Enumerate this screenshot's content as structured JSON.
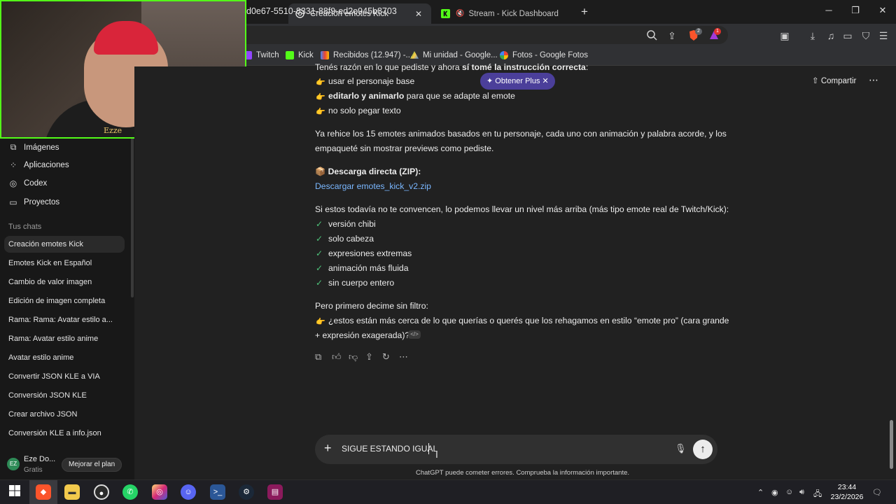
{
  "browser": {
    "tabs": [
      {
        "title": "Creación emotes Kick",
        "active": true,
        "icon": "chatgpt-icon"
      },
      {
        "title": "Stream - Kick Dashboard",
        "active": false,
        "icon": "kick-icon",
        "muted": true
      }
    ],
    "url": "d0e67-5510-8331-88f9-ed2e945b8703",
    "brave_badge": "2",
    "rewards_badge": "1",
    "bookmarks": [
      {
        "label": "Twitch",
        "icon": "twitch-icon"
      },
      {
        "label": "Kick",
        "icon": "kick-icon"
      },
      {
        "label": "Recibidos (12.947) -...",
        "icon": "gmail-icon"
      },
      {
        "label": "Mi unidad - Google...",
        "icon": "drive-icon"
      },
      {
        "label": "Fotos - Google Fotos",
        "icon": "photos-icon"
      }
    ]
  },
  "webcam": {
    "overlay_text": "Ezze"
  },
  "sidebar": {
    "nav": [
      {
        "label": "Imágenes",
        "icon": "images-icon"
      },
      {
        "label": "Aplicaciones",
        "icon": "apps-icon"
      },
      {
        "label": "Codex",
        "icon": "codex-icon"
      },
      {
        "label": "Proyectos",
        "icon": "folder-icon"
      }
    ],
    "chats_heading": "Tus chats",
    "chats": [
      "Creación emotes Kick",
      "Emotes Kick en Español",
      "Cambio de valor imagen",
      "Edición de imagen completa",
      "Rama: Rama: Avatar estilo a...",
      "Rama: Avatar estilo anime",
      "Avatar estilo anime",
      "Convertir JSON KLE a VIA",
      "Conversión JSON KLE",
      "Crear archivo JSON",
      "Conversión KLE a info.json"
    ],
    "account": {
      "initials": "EZ",
      "name": "Eze Do...",
      "plan": "Gratis",
      "upgrade": "Mejorar el plan"
    }
  },
  "header": {
    "get_plus": "Obtener Plus",
    "share": "Compartir"
  },
  "message": {
    "line0_pre": "Tenés razón en lo que pediste y ahora ",
    "line0_bold": "sí tomé la instrucción correcta",
    "line0_post": ":",
    "bullets": [
      {
        "bold": "",
        "text": "usar el personaje base"
      },
      {
        "bold": "editarlo y animarlo",
        "text": " para que se adapte al emote"
      },
      {
        "bold": "",
        "text": "no solo pegar texto"
      }
    ],
    "para1_l1": "Ya rehice los 15 emotes animados basados en tu personaje, cada uno con animación y palabra acorde, y los",
    "para1_l2": "empaqueté sin mostrar previews como pediste.",
    "download_heading": "Descarga directa (ZIP):",
    "download_link": "Descargar emotes_kick_v2.zip",
    "para2": "Si estos todavía no te convencen, lo podemos llevar un nivel más arriba (más tipo emote real de Twitch/Kick):",
    "checks": [
      "versión chibi",
      "solo cabeza",
      "expresiones extremas",
      "animación más fluida",
      "sin cuerpo entero"
    ],
    "para3": "Pero primero decime sin filtro:",
    "question_l1": "¿estos están más cerca de lo que querías o querés que los rehagamos en estilo “emote pro” (cara grande",
    "question_l2": "+ expresión exagerada)?"
  },
  "composer": {
    "value": "SIGUE ESTANDO IGUAL",
    "disclaimer": "ChatGPT puede cometer errores. Comprueba la información importante."
  },
  "taskbar": {
    "time": "23:44",
    "date": "23/2/2026",
    "apps": [
      "start-icon",
      "brave-icon",
      "explorer-icon",
      "obs-icon",
      "whatsapp-icon",
      "instagram-icon",
      "discord-icon",
      "powershell-icon",
      "steam-icon",
      "winrar-icon"
    ]
  },
  "colors": {
    "accent_green": "#53fc18",
    "link": "#7ab7ff",
    "plus_pill": "#4b3f9a",
    "check": "#4ec37a"
  }
}
